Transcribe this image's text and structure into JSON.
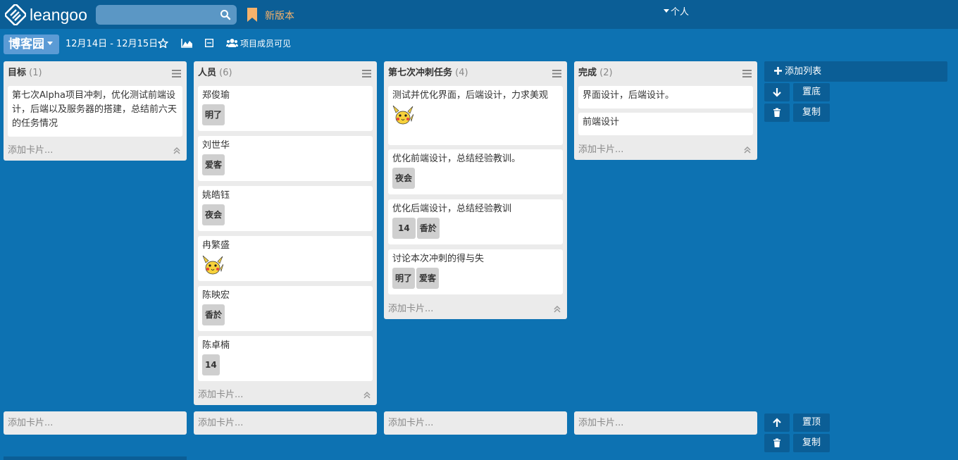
{
  "app": {
    "logo_text": "leangoo",
    "search_placeholder": "",
    "new_version": "新版本",
    "personal": "个人"
  },
  "board": {
    "name": "博客园",
    "date_range": "12月14日 - 12月15日",
    "visibility": "项目成员可见"
  },
  "colors": {
    "background": "#0d72b2",
    "topbar": "#0b5e96",
    "board_button": "#5b9bd5",
    "label": "#cfcfcf",
    "accent_new_version": "#f6b26b"
  },
  "lists": [
    {
      "title": "目标",
      "count": "(1)",
      "add_card": "添加卡片...",
      "cards": [
        {
          "text": "第七次Alpha项目冲刺，优化测试前端设计，后端以及服务器的搭建，总结前六天的任务情况",
          "labels": []
        }
      ]
    },
    {
      "title": "人员",
      "count": "(6)",
      "add_card": "添加卡片...",
      "cards": [
        {
          "text": "郑俊瑜",
          "labels": [
            "明了"
          ]
        },
        {
          "text": "刘世华",
          "labels": [
            "爱客"
          ]
        },
        {
          "text": "姚皓钰",
          "labels": [
            "夜会"
          ]
        },
        {
          "text": "冉繁盛",
          "labels": [],
          "image": "pikachu-sticker"
        },
        {
          "text": "陈映宏",
          "labels": [
            "香於"
          ]
        },
        {
          "text": "陈卓楠",
          "labels": [
            "14"
          ]
        }
      ]
    },
    {
      "title": "第七次冲刺任务",
      "count": "(4)",
      "add_card": "添加卡片...",
      "cards": [
        {
          "text": "测试并优化界面，后端设计，力求美观",
          "labels": [],
          "image": "pikachu-sticker"
        },
        {
          "text": "优化前端设计，总结经验教训。",
          "labels": [
            "夜会"
          ]
        },
        {
          "text": "优化后端设计，总结经验教训",
          "labels": [
            "14",
            "香於"
          ]
        },
        {
          "text": "讨论本次冲刺的得与失",
          "labels": [
            "明了",
            "爱客"
          ]
        }
      ]
    },
    {
      "title": "完成",
      "count": "(2)",
      "add_card": "添加卡片...",
      "cards": [
        {
          "text": "界面设计，后端设计。",
          "labels": []
        },
        {
          "text": "前端设计",
          "labels": []
        }
      ]
    }
  ],
  "bottom_lists": [
    {
      "add_card": "添加卡片..."
    },
    {
      "add_card": "添加卡片..."
    },
    {
      "add_card": "添加卡片..."
    },
    {
      "add_card": "添加卡片..."
    }
  ],
  "side_actions": {
    "add_list": "添加列表",
    "to_bottom": "置底",
    "copy": "复制",
    "to_top": "置顶",
    "copy2": "复制"
  },
  "icons": [
    "leangoo-logo-icon",
    "search-icon",
    "bookmark-icon",
    "star-icon",
    "chart-icon",
    "minus-square-icon",
    "users-icon",
    "menu-icon",
    "collapse-up-icon",
    "arrow-down-icon",
    "arrow-up-icon",
    "trash-icon",
    "plus-icon"
  ]
}
